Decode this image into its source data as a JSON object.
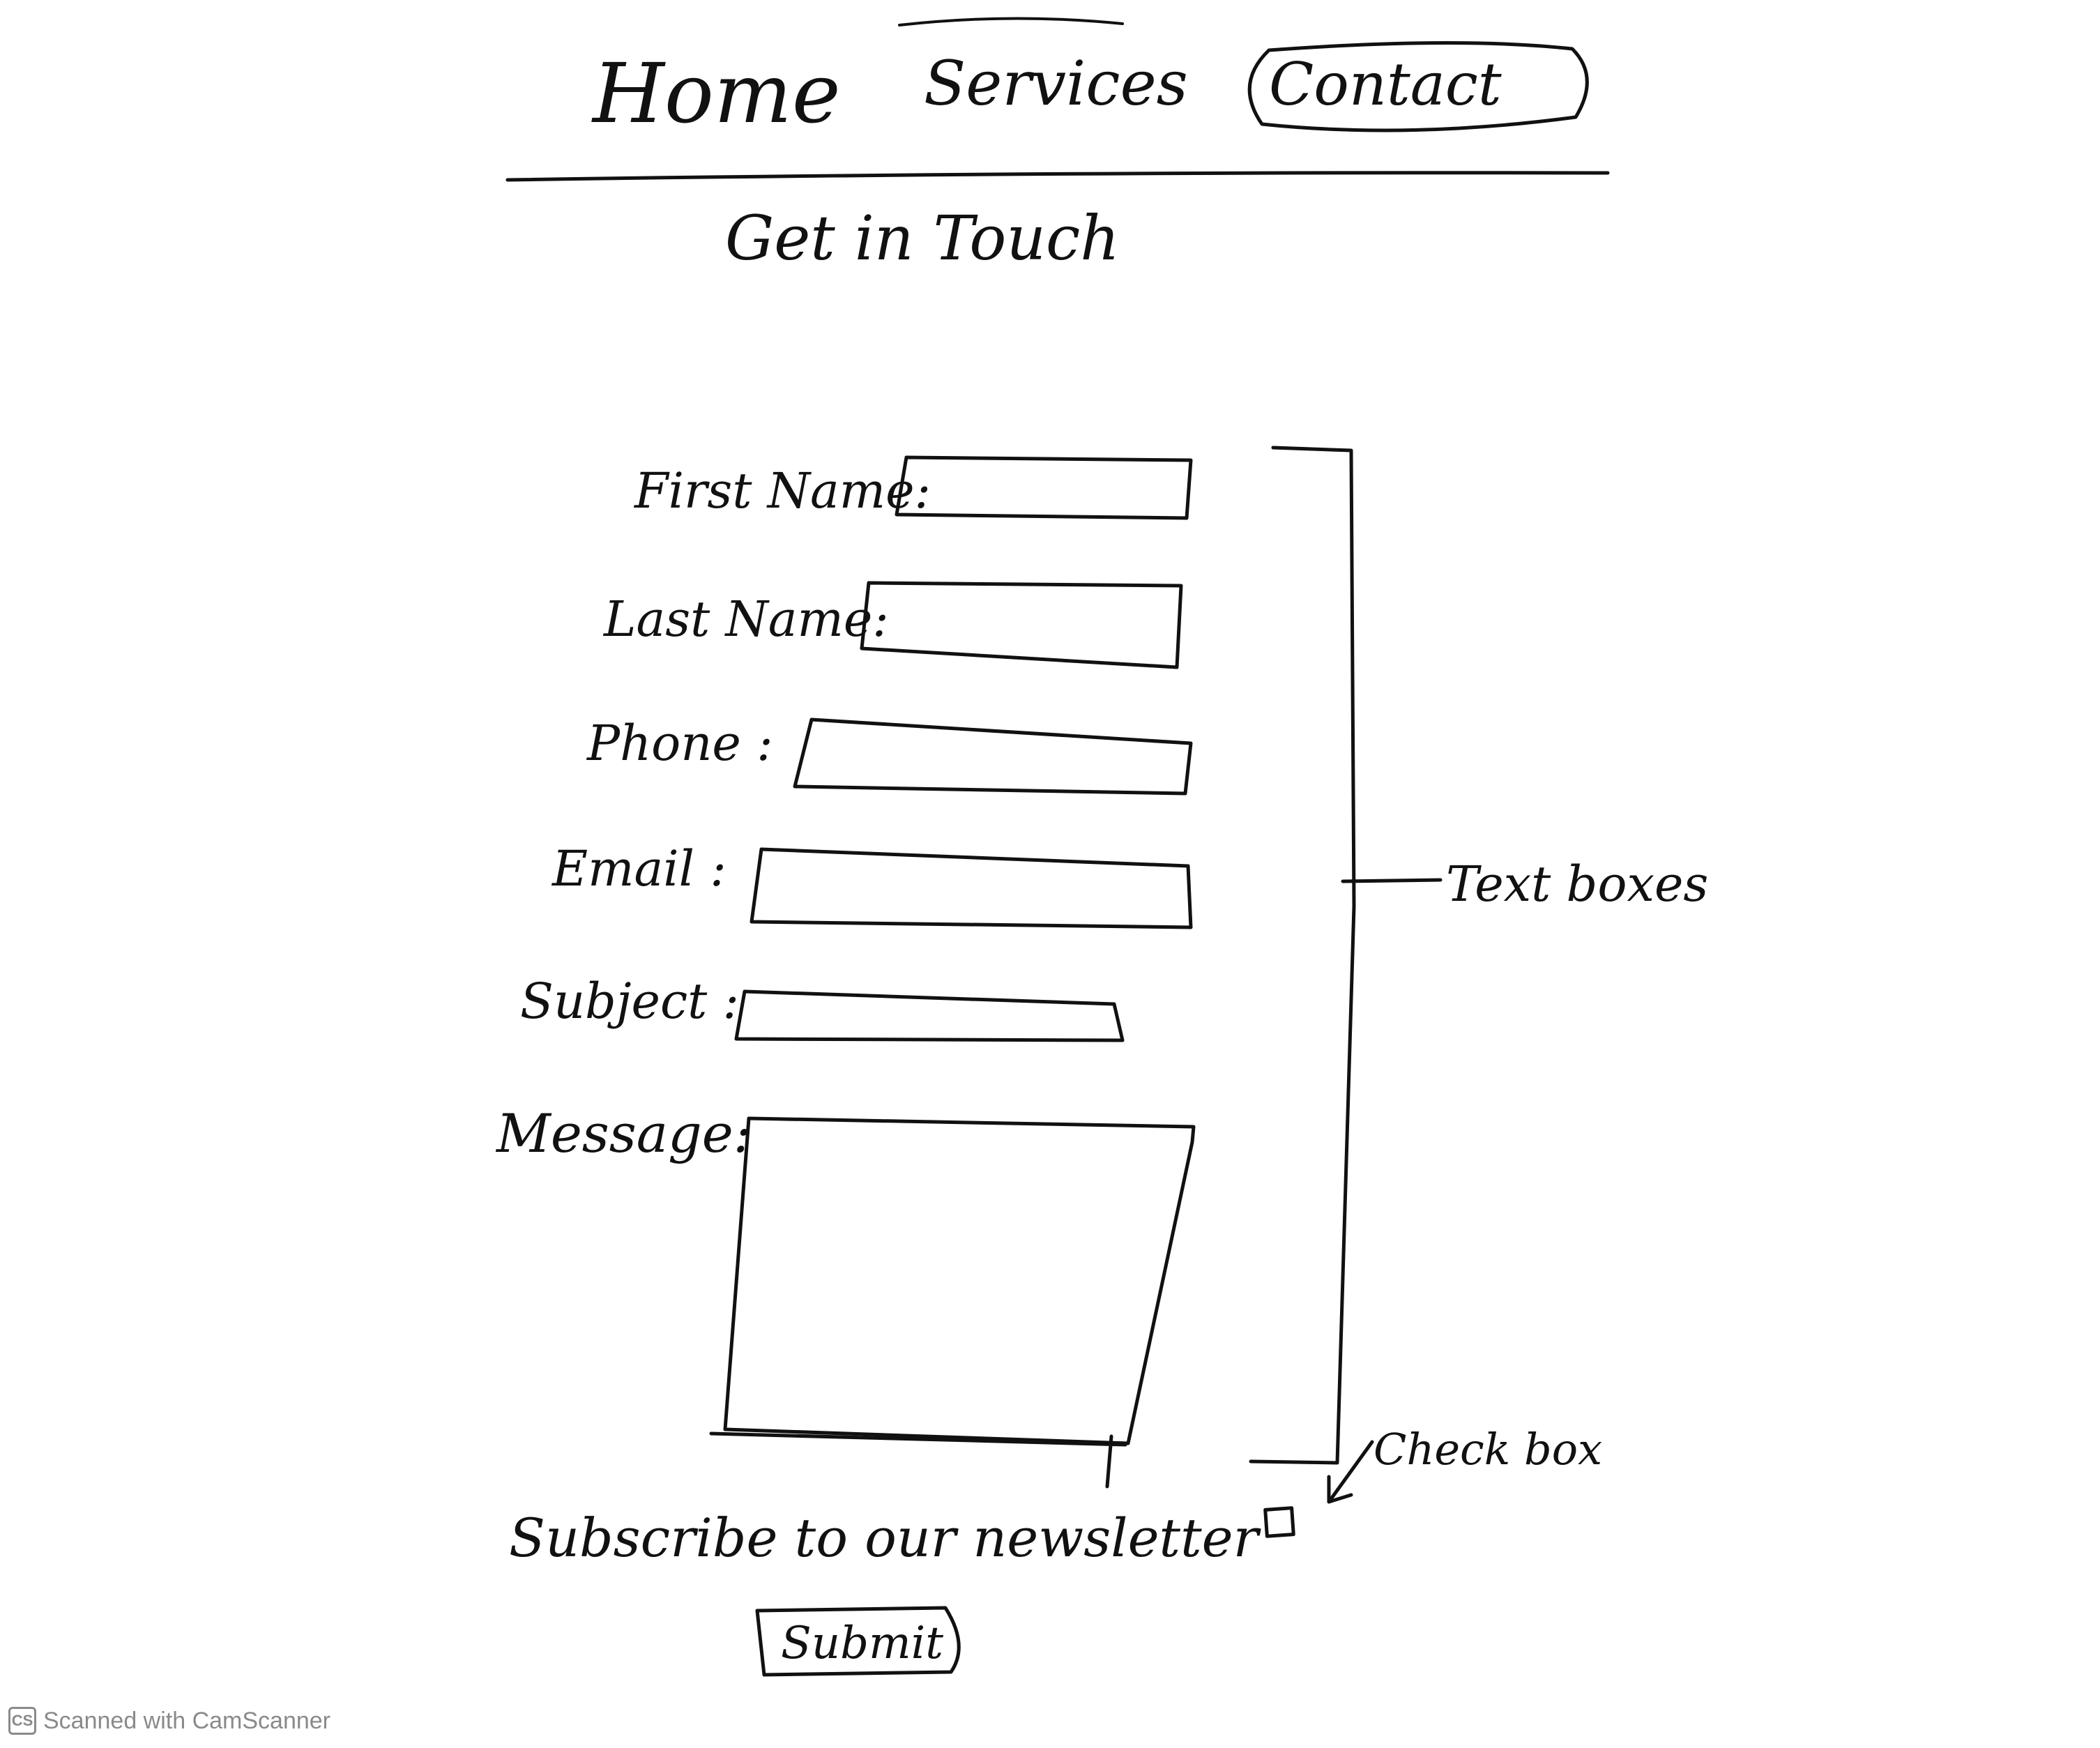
{
  "nav": {
    "items": [
      {
        "label": "Home"
      },
      {
        "label": "Services"
      },
      {
        "label": "Contact"
      }
    ]
  },
  "page": {
    "heading": "Get in Touch"
  },
  "form": {
    "fields": [
      {
        "label": "First Name:"
      },
      {
        "label": "Last Name:"
      },
      {
        "label": "Phone :"
      },
      {
        "label": "Email :"
      },
      {
        "label": "Subject :"
      },
      {
        "label": "Message:"
      }
    ],
    "newsletter_label": "Subscribe to our newsletter",
    "newsletter_checked": false,
    "submit_label": "Submit"
  },
  "annotations": {
    "text_boxes": "Text boxes",
    "check_box": "Check box"
  },
  "watermark": {
    "logo": "CS",
    "text": "Scanned with CamScanner"
  }
}
